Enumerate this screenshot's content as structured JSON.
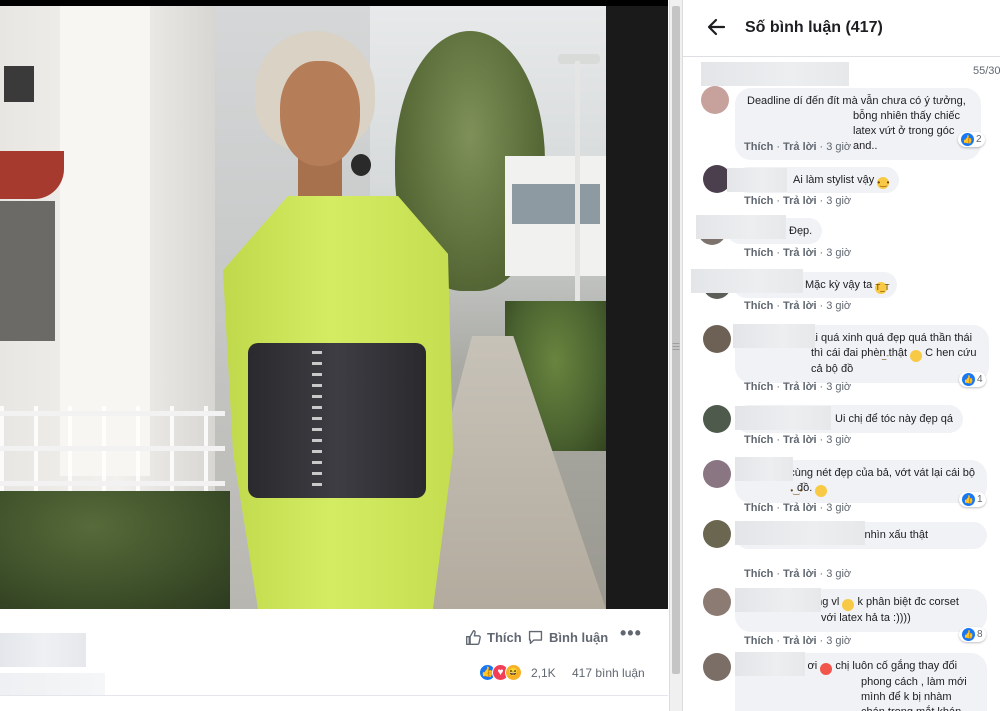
{
  "post": {
    "like_label": "Thích",
    "comment_label": "Bình luận",
    "more_label": "•••",
    "reaction_count": "2,1K",
    "comment_count": "417 bình luận"
  },
  "panel": {
    "title": "Số bình luận (417)",
    "counter": "55/30"
  },
  "comments": [
    {
      "text": "Deadline dí đến đít mà vẫn chưa có ý tưởng, bỗng nhiên thấy chiếc latex vứt ở trong góc and..",
      "like": "Thích",
      "reply": "Trả lời",
      "time": "3 giờ",
      "likes": "2"
    },
    {
      "text": "Ai làm stylist vậy",
      "like": "Thích",
      "reply": "Trả lời",
      "time": "3 giờ"
    },
    {
      "text": "Đẹp.",
      "like": "Thích",
      "reply": "Trả lời",
      "time": "3 giờ"
    },
    {
      "text": "Mặc kỳ vậy ta",
      "like": "Thích",
      "reply": "Trả lời",
      "time": "3 giờ"
    },
    {
      "text": "Nếu mà k phải quá xinh quá đẹp quá thần thái thì cái đai phèn thật",
      "text2": "C hen cứu cả bộ đồ",
      "like": "Thích",
      "reply": "Trả lời",
      "time": "3 giờ",
      "likes": "4"
    },
    {
      "text": "Ui chị để tóc này đẹp qá",
      "like": "Thích",
      "reply": "Trả lời",
      "time": "3 giờ"
    },
    {
      "text": "hần thái cùng nét đẹp của bả, vớt vát lại cái bộ đồ.",
      "like": "Thích",
      "reply": "Trả lời",
      "time": "3 giờ",
      "likes": "1"
    },
    {
      "text": "Thích hen nhưng bộ đồ nhìn xấu thật",
      "like": "Thích",
      "reply": "Trả lời",
      "time": "3 giờ"
    },
    {
      "text": "Stylish quá đáng vl",
      "text2": "k phân biệt đc corset với latex hả ta :))))",
      "like": "Thích",
      "reply": "Trả lời",
      "time": "3 giờ",
      "likes": "8"
    },
    {
      "text": "Xinh xỉu má ơi",
      "text2": "chị luôn cố gắng thay đổi phong cách , làm mới mình để k bị nhàm chán trong mắt khán giả ."
    }
  ],
  "colors": {
    "accent": "#1877f2",
    "bubble": "#f0f2f5",
    "meta": "#606770"
  },
  "icons": [
    "back-arrow-icon",
    "like-thumb-icon",
    "comment-bubble-icon",
    "more-icon",
    "like-reaction-icon",
    "love-reaction-icon",
    "haha-reaction-icon"
  ]
}
